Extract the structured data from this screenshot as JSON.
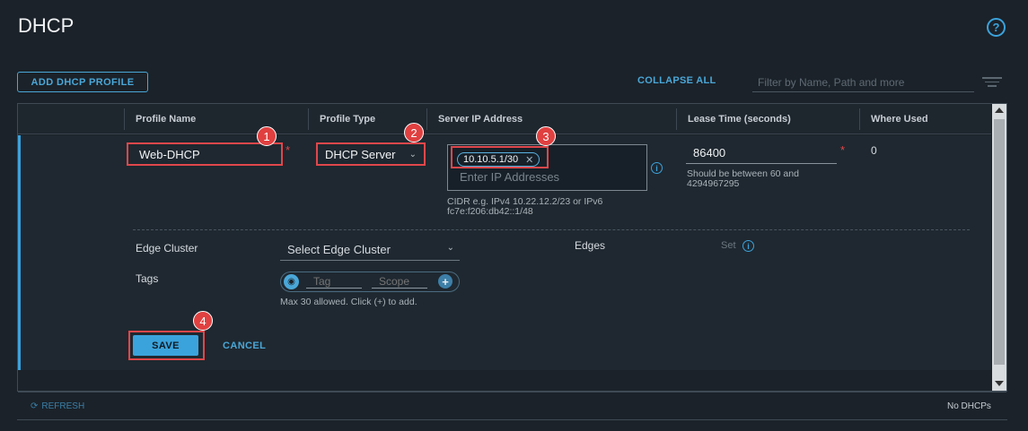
{
  "page": {
    "title": "DHCP",
    "help": "?"
  },
  "toolbar": {
    "add_profile": "ADD DHCP PROFILE",
    "collapse_all": "COLLAPSE ALL",
    "filter_placeholder": "Filter by Name, Path and more"
  },
  "columns": [
    "Profile Name",
    "Profile Type",
    "Server IP Address",
    "Lease Time (seconds)",
    "Where Used"
  ],
  "form": {
    "profile_name": "Web-DHCP",
    "profile_type": "DHCP Server",
    "server_ip_chip": "10.10.5.1/30",
    "server_ip_placeholder": "Enter IP Addresses",
    "server_ip_hint_1": "CIDR e.g. IPv4 10.22.12.2/23 or IPv6",
    "server_ip_hint_2": "fc7e:f206:db42::1/48",
    "lease_time": "86400",
    "lease_hint_1": "Should be between 60 and",
    "lease_hint_2": "4294967295",
    "where_used": "0",
    "required_mark": "*",
    "edge_cluster_label": "Edge Cluster",
    "edge_cluster_value": "Select Edge Cluster",
    "edges_label": "Edges",
    "edges_set": "Set",
    "tags_label": "Tags",
    "tag_placeholder": "Tag",
    "scope_placeholder": "Scope",
    "tags_hint": "Max 30 allowed. Click (+) to add.",
    "save": "SAVE",
    "cancel": "CANCEL"
  },
  "callouts": [
    "1",
    "2",
    "3",
    "4"
  ],
  "footer": {
    "refresh": "REFRESH",
    "count": "No DHCPs"
  },
  "colors": {
    "accent": "#3ba3dc",
    "highlight": "#e0474b",
    "background": "#1b2229"
  }
}
